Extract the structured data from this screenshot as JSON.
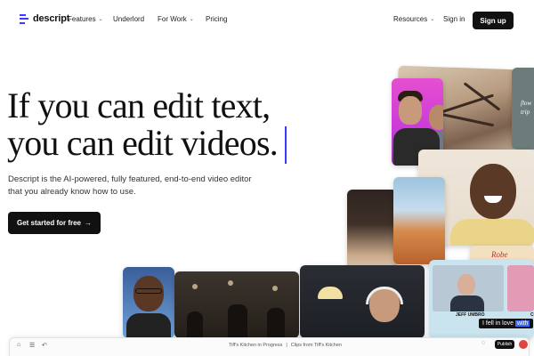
{
  "brand": {
    "name": "descript",
    "accent": "#3b3bff"
  },
  "nav": {
    "items": [
      {
        "label": "Features",
        "dropdown": true
      },
      {
        "label": "Underlord",
        "dropdown": false
      },
      {
        "label": "For Work",
        "dropdown": true
      },
      {
        "label": "Pricing",
        "dropdown": false
      }
    ],
    "resources": "Resources",
    "sign_in": "Sign in",
    "sign_up": "Sign up"
  },
  "hero": {
    "headline_line1": "If you can edit text,",
    "headline_line2": "you can edit videos.",
    "subtext": "Descript is the AI-powered, fully featured, end-to-end video editor that you already know how to use.",
    "cta_label": "Get started for free",
    "cta_arrow": "→"
  },
  "collage": {
    "text_tile_lines": [
      "flow",
      "trip"
    ],
    "robe_text": "Robe",
    "call_caption_left": "JEFF UMBRO",
    "call_caption_right": "CO",
    "subtitle_prefix": "I fell in love ",
    "subtitle_highlight": "with"
  },
  "appbar": {
    "crumb_project": "Tiff's Kitchen in Progress",
    "crumb_separator": "|",
    "crumb_clips": "Clips from Tiff's Kitchen",
    "publish": "Publish"
  }
}
